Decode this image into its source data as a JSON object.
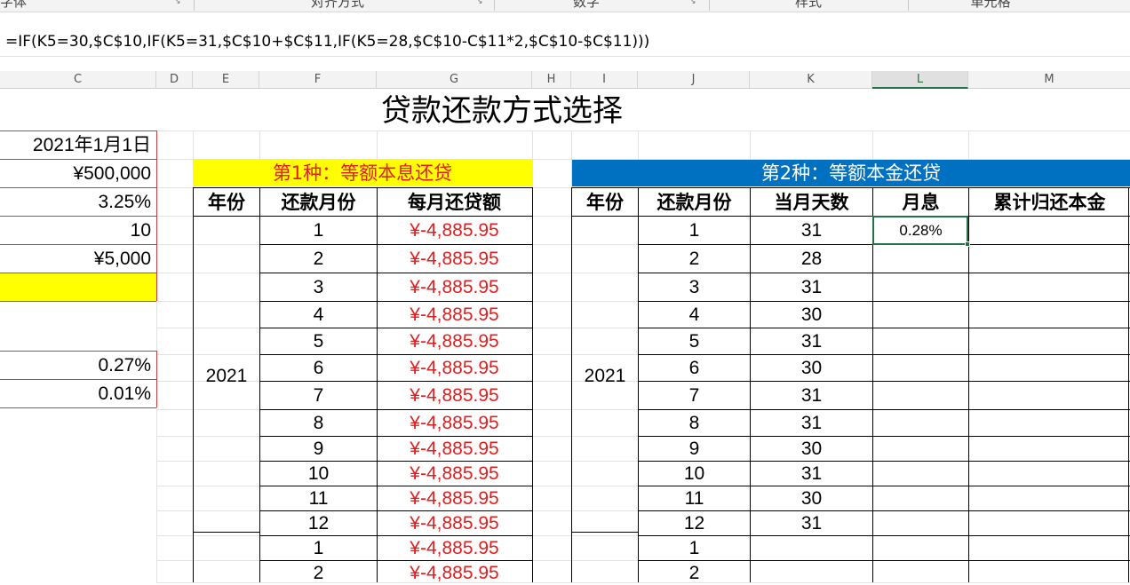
{
  "ribbon": {
    "groups": [
      "字体",
      "对齐方式",
      "数字",
      "样式",
      "单元格"
    ]
  },
  "formula_bar": {
    "formula": "=IF(K5=30,$C$10,IF(K5=31,$C$10+$C$11,IF(K5=28,$C$10-C$11*2,$C$10-$C$11)))"
  },
  "columns": [
    "C",
    "D",
    "E",
    "F",
    "G",
    "H",
    "I",
    "J",
    "K",
    "L",
    "M"
  ],
  "title": "贷款还款方式选择",
  "left_params": [
    "2021年1月1日",
    "¥500,000",
    "3.25%",
    "10",
    "¥5,000",
    "",
    "",
    "0.27%",
    "0.01%"
  ],
  "left_params_highlight_color": "#ffff00",
  "table1": {
    "title": "第1种：等额本息还贷",
    "title_bg": "#ffff00",
    "title_color": "#e02020",
    "headers": [
      "年份",
      "还款月份",
      "每月还贷额"
    ],
    "year": "2021",
    "rows": [
      [
        "1",
        "¥-4,885.95"
      ],
      [
        "2",
        "¥-4,885.95"
      ],
      [
        "3",
        "¥-4,885.95"
      ],
      [
        "4",
        "¥-4,885.95"
      ],
      [
        "5",
        "¥-4,885.95"
      ],
      [
        "6",
        "¥-4,885.95"
      ],
      [
        "7",
        "¥-4,885.95"
      ],
      [
        "8",
        "¥-4,885.95"
      ],
      [
        "9",
        "¥-4,885.95"
      ],
      [
        "10",
        "¥-4,885.95"
      ],
      [
        "11",
        "¥-4,885.95"
      ],
      [
        "12",
        "¥-4,885.95"
      ],
      [
        "1",
        "¥-4,885.95"
      ],
      [
        "2",
        "¥-4,885.95"
      ]
    ],
    "amount_color": "#e02020"
  },
  "table2": {
    "title": "第2种：等额本金还贷",
    "title_bg": "#0070c0",
    "title_color": "#ffffff",
    "headers": [
      "年份",
      "还款月份",
      "当月天数",
      "月息",
      "累计归还本金"
    ],
    "year": "2021",
    "rows": [
      [
        "1",
        "31",
        "0.28%"
      ],
      [
        "2",
        "28",
        ""
      ],
      [
        "3",
        "31",
        ""
      ],
      [
        "4",
        "30",
        ""
      ],
      [
        "5",
        "31",
        ""
      ],
      [
        "6",
        "30",
        ""
      ],
      [
        "7",
        "31",
        ""
      ],
      [
        "8",
        "31",
        ""
      ],
      [
        "9",
        "30",
        ""
      ],
      [
        "10",
        "31",
        ""
      ],
      [
        "11",
        "30",
        ""
      ],
      [
        "12",
        "31",
        ""
      ],
      [
        "1",
        "",
        ""
      ],
      [
        "2",
        "",
        ""
      ]
    ],
    "selection_color": "#217346"
  }
}
